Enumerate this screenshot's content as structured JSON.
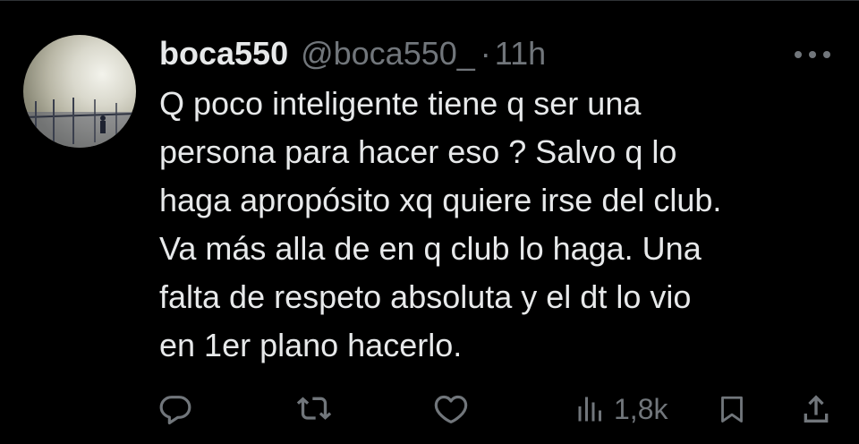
{
  "tweet": {
    "display_name": "boca550",
    "handle": "@boca550_",
    "separator": "·",
    "time": "11h",
    "text": "Q poco inteligente tiene q ser una\npersona para hacer eso ? Salvo q lo\nhaga apropósito xq quiere irse del club.\nVa más alla de en q club lo haga. Una\nfalta de respeto absoluta y el dt lo vio\nen 1er plano hacerlo.",
    "views": "1,8k"
  },
  "icons": {
    "more": "more-horizontal-icon",
    "reply": "reply-icon",
    "retweet": "retweet-icon",
    "like": "like-icon",
    "views": "views-icon",
    "bookmark": "bookmark-icon",
    "share": "share-icon"
  },
  "colors": {
    "background": "#000000",
    "text": "#e7e9ea",
    "secondary": "#71767b",
    "divider": "#2f3336"
  }
}
